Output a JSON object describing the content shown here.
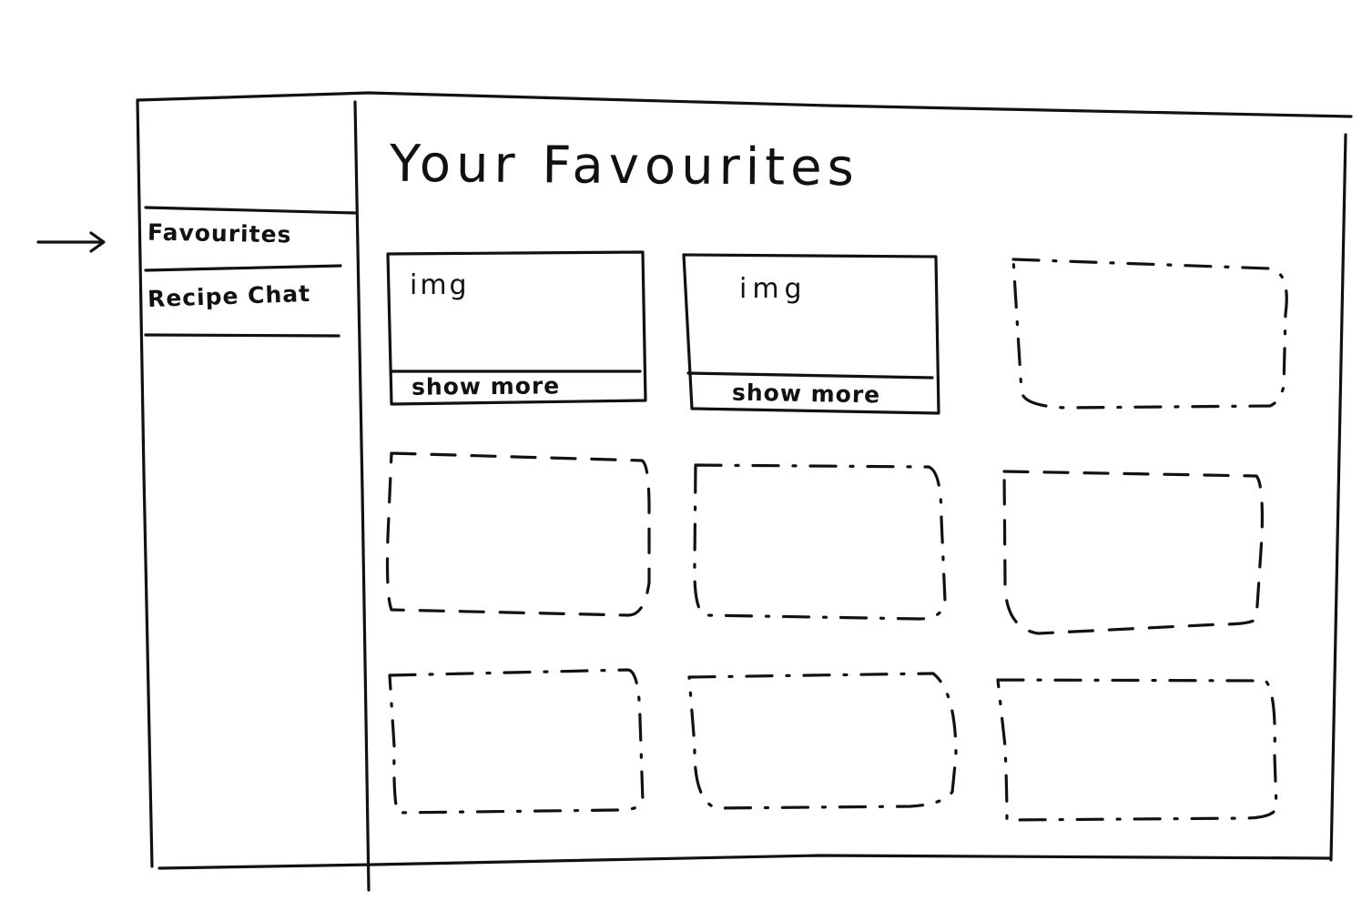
{
  "main": {
    "title": "Your Favourites"
  },
  "sidebar": {
    "items": [
      {
        "label": "Favourites",
        "selected": true
      },
      {
        "label": "Recipe Chat",
        "selected": false
      }
    ]
  },
  "favourites": {
    "cards": [
      {
        "image_label": "img",
        "button_label": "show more"
      },
      {
        "image_label": "img",
        "button_label": "show more"
      }
    ],
    "placeholder_slots": 7
  }
}
